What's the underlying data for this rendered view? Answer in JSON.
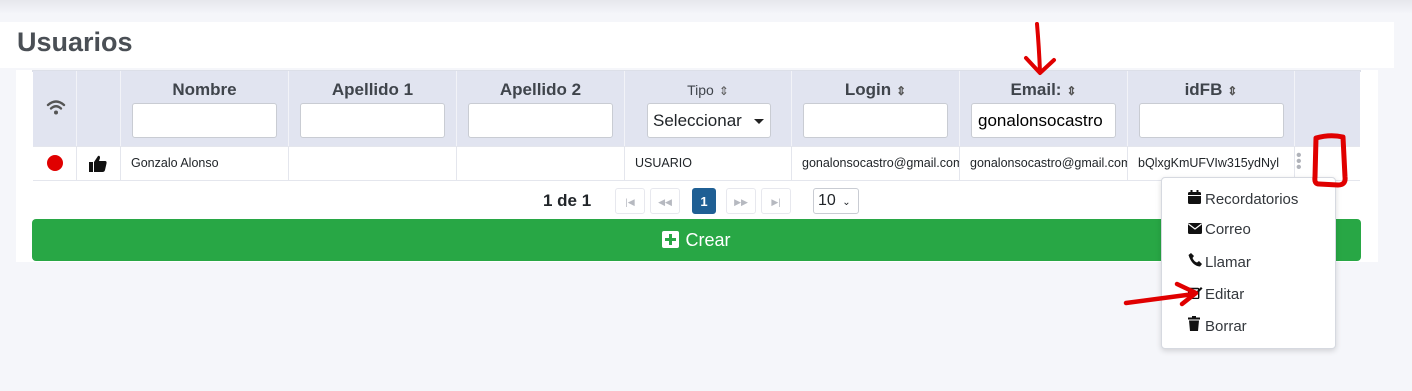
{
  "page_title": "Usuarios",
  "columns": {
    "nombre": "Nombre",
    "apellido1": "Apellido 1",
    "apellido2": "Apellido 2",
    "tipo": "Tipo",
    "login": "Login",
    "email": "Email:",
    "idfb": "idFB"
  },
  "filters": {
    "nombre": "",
    "apellido1": "",
    "apellido2": "",
    "tipo": "Seleccionar",
    "login": "",
    "email": "gonalonsocastro",
    "idfb": ""
  },
  "row": {
    "nombre": "Gonzalo Alonso",
    "apellido1": "",
    "apellido2": "",
    "tipo": "USUARIO",
    "login": "gonalonsocastro@gmail.com",
    "email": "gonalonsocastro@gmail.com",
    "idfb": "bQlxgKmUFVIw315ydNyl"
  },
  "pagination": {
    "status": "1 de 1",
    "current_page": "1",
    "page_size": "10"
  },
  "create_button": "Crear",
  "context_menu": [
    {
      "label": "Recordatorios",
      "icon": "calendar-icon"
    },
    {
      "label": "Correo",
      "icon": "envelope-icon"
    },
    {
      "label": "Llamar",
      "icon": "phone-icon"
    },
    {
      "label": "Editar",
      "icon": "edit-icon"
    },
    {
      "label": "Borrar",
      "icon": "trash-icon"
    }
  ],
  "colors": {
    "header_bg": "#e1e4f0",
    "create_button": "#28a745",
    "active_page": "#1f5f94",
    "status_dot": "#e00000",
    "annotation": "#e00000"
  }
}
